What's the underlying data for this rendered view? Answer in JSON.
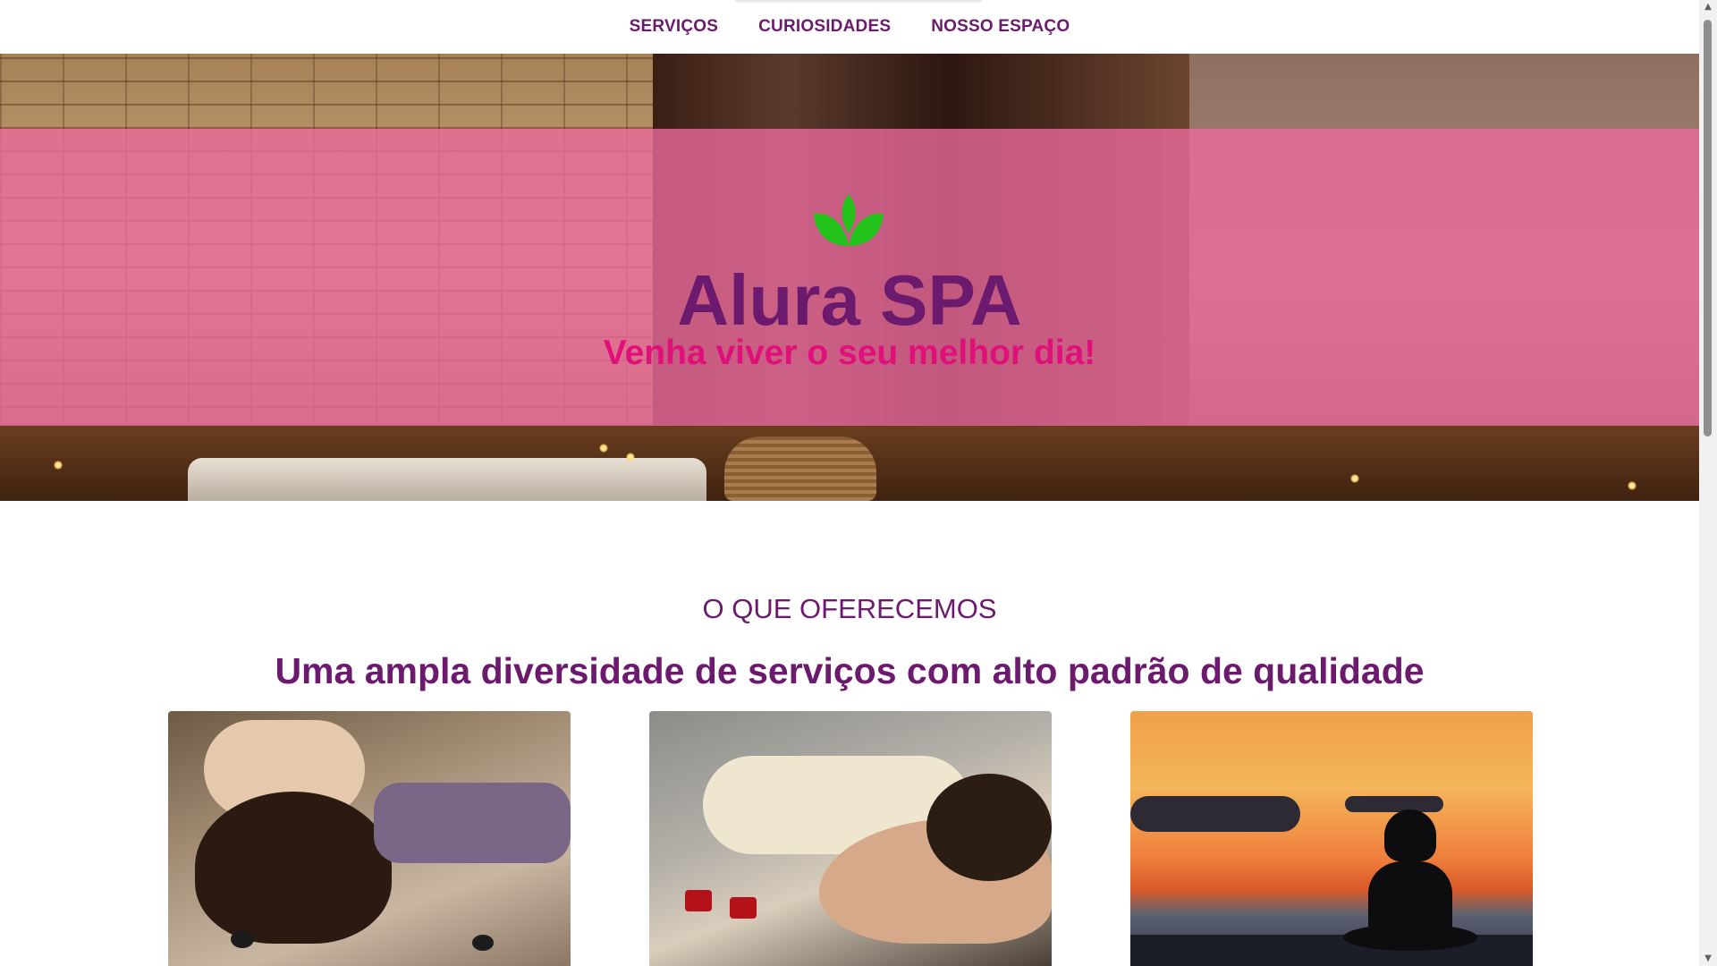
{
  "nav": {
    "items": [
      {
        "label": "SERVIÇOS"
      },
      {
        "label": "CURIOSIDADES"
      },
      {
        "label": "NOSSO ESPAÇO"
      }
    ]
  },
  "hero": {
    "logo_icon": "lotus-icon",
    "title": "Alura SPA",
    "subtitle": "Venha viver o seu melhor dia!",
    "overlay_color": "#e9699b"
  },
  "services": {
    "kicker": "O QUE OFERECEMOS",
    "title": "Uma ampla diversidade de serviços com alto padrão de qualidade"
  },
  "scrollbar": {
    "up_icon": "scroll-up-arrow-icon",
    "down_icon": "scroll-down-arrow-icon",
    "up_glyph": "▲",
    "down_glyph": "▼"
  },
  "colors": {
    "brand_purple": "#6b1a6e",
    "brand_pink": "#e0107a",
    "leaf_green": "#22c21b"
  }
}
